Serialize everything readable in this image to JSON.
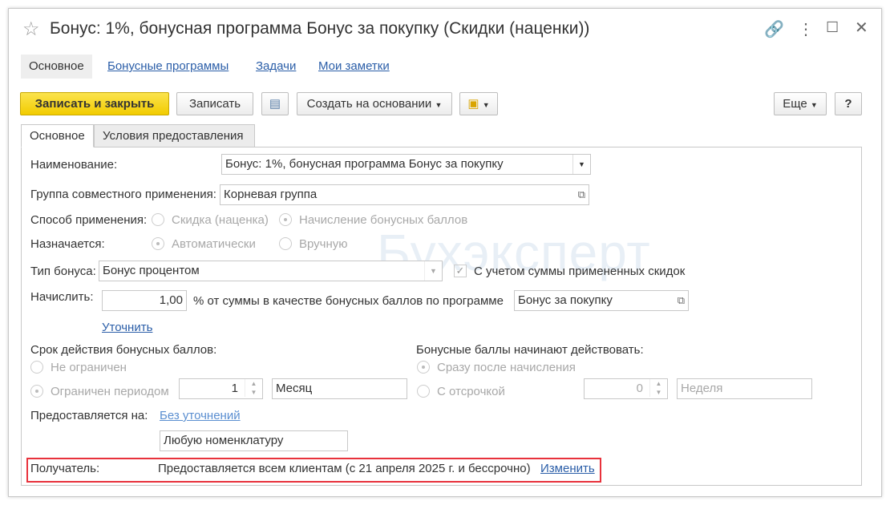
{
  "window": {
    "title": "Бонус: 1%, бонусная программа Бонус за покупку (Скидки (наценки))"
  },
  "nav": [
    "Основное",
    "Бонусные программы",
    "Задачи",
    "Мои заметки"
  ],
  "toolbar": {
    "save_close": "Записать и закрыть",
    "save": "Записать",
    "create_based": "Создать на основании",
    "more": "Еще",
    "help": "?"
  },
  "tabs": [
    "Основное",
    "Условия предоставления"
  ],
  "watermark": "Бухэксперт",
  "form": {
    "name_label": "Наименование:",
    "name_value": "Бонус: 1%, бонусная программа Бонус за покупку",
    "group_label": "Группа совместного применения:",
    "group_value": "Корневая группа",
    "method_label": "Способ применения:",
    "method_options": [
      "Скидка (наценка)",
      "Начисление бонусных баллов"
    ],
    "assigned_label": "Назначается:",
    "assigned_options": [
      "Автоматически",
      "Вручную"
    ],
    "bonus_type_label": "Тип бонуса:",
    "bonus_type_value": "Бонус процентом",
    "consider_discounts": "С учетом суммы примененных скидок",
    "accrue_label": "Начислить:",
    "accrue_value": "1,00",
    "accrue_text": "% от суммы в качестве бонусных баллов по программе",
    "program_value": "Бонус за покупку",
    "refine_link": "Уточнить",
    "validity_label": "Срок действия бонусных баллов:",
    "validity_unlimited": "Не ограничен",
    "validity_period": "Ограничен периодом",
    "validity_count": "1",
    "validity_unit": "Месяц",
    "start_label": "Бонусные баллы начинают действовать:",
    "start_immediate": "Сразу после начисления",
    "start_delay": "С отсрочкой",
    "delay_count": "0",
    "delay_unit": "Неделя",
    "provided_label": "Предоставляется на:",
    "provided_link": "Без уточнений",
    "provided_value": "Любую номенклатуру",
    "recipient_label": "Получатель:",
    "recipient_value": "Предоставляется всем клиентам (с 21 апреля 2025 г. и бессрочно)",
    "recipient_link": "Изменить"
  },
  "colors": {
    "primary": "#f2cc00",
    "link": "#2b5ea8",
    "highlight": "#e8323c"
  }
}
